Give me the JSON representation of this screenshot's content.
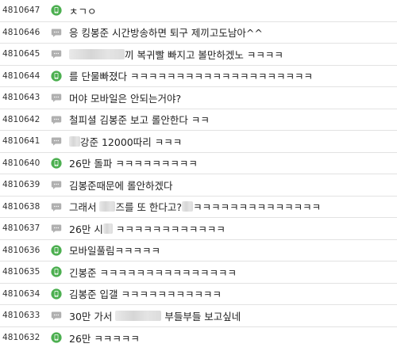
{
  "colors": {
    "mobile_icon": "#4caf50",
    "bubble_icon": "#b0b0b0",
    "divider": "#e2e2e2"
  },
  "rows": [
    {
      "id": "4810647",
      "icon": "mobile-icon",
      "parts": [
        "ㅊㄱㅇ"
      ]
    },
    {
      "id": "4810646",
      "icon": "chat-bubble-icon",
      "parts": [
        "응 킹봉준 시간방송하면 퇴구 제끼고도남아^^"
      ]
    },
    {
      "id": "4810645",
      "icon": "chat-bubble-icon",
      "blur_before": 70,
      "parts": [
        "끼 복귀빨 빠지고 볼만하겠노 ㅋㅋㅋㅋ"
      ]
    },
    {
      "id": "4810644",
      "icon": "mobile-icon",
      "parts": [
        "를 단물빠졌다 ㅋㅋㅋㅋㅋㅋㅋㅋㅋㅋㅋㅋㅋㅋㅋㅋㅋㅋㅋㅋ"
      ]
    },
    {
      "id": "4810643",
      "icon": "chat-bubble-icon",
      "parts": [
        "머야 모바일은 안되는거야?"
      ]
    },
    {
      "id": "4810642",
      "icon": "chat-bubble-icon",
      "parts": [
        "철피셜 김봉준 보고 롤안한다 ㅋㅋ"
      ]
    },
    {
      "id": "4810641",
      "icon": "chat-bubble-icon",
      "blur_before": 14,
      "parts": [
        "강준 12000따리 ㅋㅋㅋ"
      ]
    },
    {
      "id": "4810640",
      "icon": "mobile-icon",
      "parts": [
        "26만 돌파 ㅋㅋㅋㅋㅋㅋㅋㅋㅋ"
      ]
    },
    {
      "id": "4810639",
      "icon": "chat-bubble-icon",
      "parts": [
        "김봉준때문에 롤안하겠다"
      ]
    },
    {
      "id": "4810638",
      "icon": "chat-bubble-icon",
      "mid_blur_after_first": 20,
      "second_blur": 14,
      "parts": [
        "그래서 ",
        "즈를 또 한다고?",
        "ㅋㅋㅋㅋㅋㅋㅋㅋㅋㅋㅋㅋㅋㅋ"
      ]
    },
    {
      "id": "4810637",
      "icon": "chat-bubble-icon",
      "mid_blur_after_first": 12,
      "parts": [
        "26만 시",
        " ㅋㅋㅋㅋㅋㅋㅋㅋㅋㅋㅋㅋ"
      ]
    },
    {
      "id": "4810636",
      "icon": "mobile-icon",
      "parts": [
        "모바일풀림ㅋㅋㅋㅋㅋ"
      ]
    },
    {
      "id": "4810635",
      "icon": "mobile-icon",
      "parts": [
        "긴봉준 ㅋㅋㅋㅋㅋㅋㅋㅋㅋㅋㅋㅋㅋㅋㅋ"
      ]
    },
    {
      "id": "4810634",
      "icon": "mobile-icon",
      "parts": [
        "김봉준 입갤 ㅋㅋㅋㅋㅋㅋㅋㅋㅋㅋㅋ"
      ]
    },
    {
      "id": "4810633",
      "icon": "chat-bubble-icon",
      "mid_blur_after_first": 58,
      "parts": [
        "30만 가서 ",
        " 부들부들 보고싶네"
      ]
    },
    {
      "id": "4810632",
      "icon": "mobile-icon",
      "parts": [
        "26만 ㅋㅋㅋㅋㅋ"
      ]
    }
  ]
}
